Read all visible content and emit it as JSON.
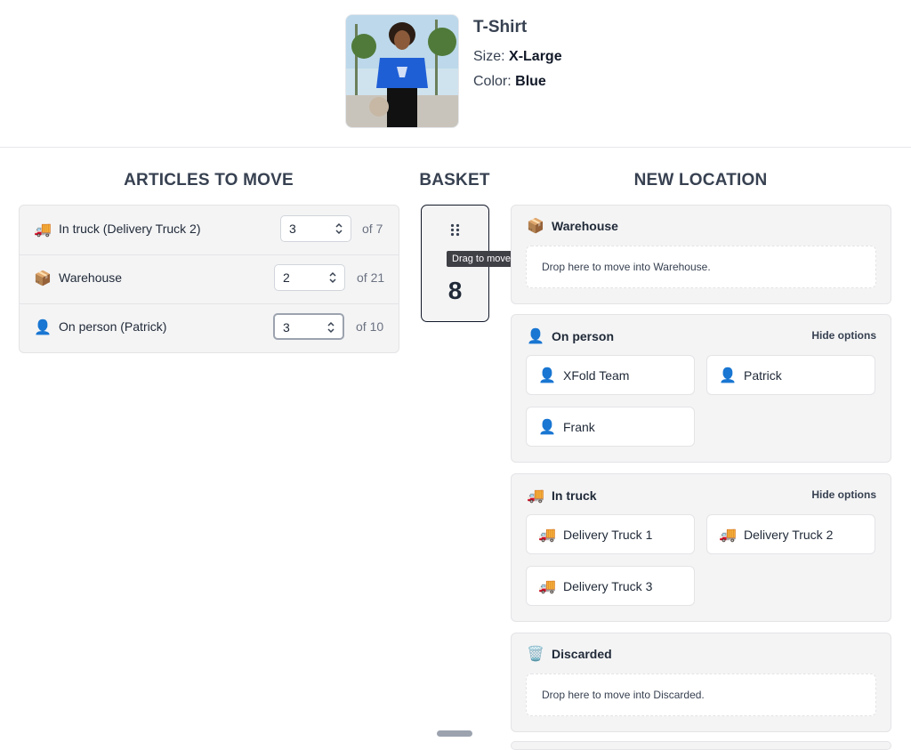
{
  "product": {
    "title": "T-Shirt",
    "size_label": "Size:",
    "size_value": "X-Large",
    "color_label": "Color:",
    "color_value": "Blue"
  },
  "columns": {
    "articles": "ARTICLES TO MOVE",
    "basket": "BASKET",
    "new_location": "NEW LOCATION"
  },
  "articles": [
    {
      "icon": "truck-icon",
      "emoji": "🚚",
      "label": "In truck (Delivery Truck 2)",
      "value": "3",
      "of": "of 7"
    },
    {
      "icon": "package-icon",
      "emoji": "📦",
      "label": "Warehouse",
      "value": "2",
      "of": "of 21"
    },
    {
      "icon": "person-icon",
      "emoji": "👤",
      "label": "On person (Patrick)",
      "value": "3",
      "of": "of 10"
    }
  ],
  "basket": {
    "count": "8",
    "tooltip": "Drag to move",
    "drag_glyph": "⠿"
  },
  "locations": {
    "warehouse": {
      "emoji": "📦",
      "label": "Warehouse",
      "drop_text": "Drop here to move into Warehouse."
    },
    "on_person": {
      "emoji": "👤",
      "label": "On person",
      "hide": "Hide options",
      "options": [
        {
          "emoji": "👤",
          "label": "XFold Team"
        },
        {
          "emoji": "👤",
          "label": "Patrick"
        },
        {
          "emoji": "👤",
          "label": "Frank"
        }
      ]
    },
    "in_truck": {
      "emoji": "🚚",
      "label": "In truck",
      "hide": "Hide options",
      "options": [
        {
          "emoji": "🚚",
          "label": "Delivery Truck 1"
        },
        {
          "emoji": "🚚",
          "label": "Delivery Truck 2"
        },
        {
          "emoji": "🚚",
          "label": "Delivery Truck 3"
        }
      ]
    },
    "discarded": {
      "emoji": "🗑️",
      "label": "Discarded",
      "drop_text": "Drop here to move into Discarded."
    }
  },
  "colors": {
    "accent_shirt": "#1f5fd6",
    "panel_bg": "#f4f4f5",
    "border": "#e4e4e7"
  }
}
